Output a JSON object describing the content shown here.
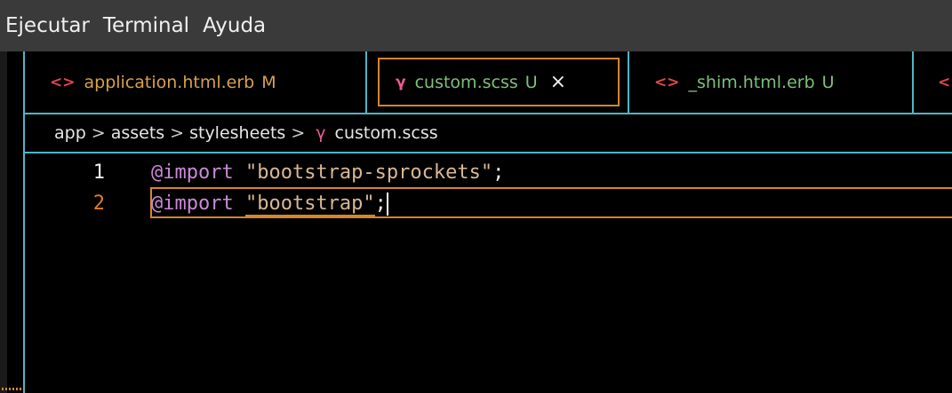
{
  "menu": {
    "items": [
      "Ejecutar",
      "Terminal",
      "Ayuda"
    ]
  },
  "tabs": [
    {
      "icon": "<>",
      "label": "application.html.erb",
      "status": "M",
      "icon_color": "#e0484c",
      "label_color": "#d6a24a"
    },
    {
      "icon": "γ",
      "label": "custom.scss",
      "status": "U",
      "icon_color": "#ee5b96",
      "label_color": "#7ec07a",
      "close": "×"
    },
    {
      "icon": "<>",
      "label": "_shim.html.erb",
      "status": "U",
      "icon_color": "#e0484c",
      "label_color": "#7ec07a"
    },
    {
      "icon": "<",
      "icon_color": "#e0484c"
    }
  ],
  "breadcrumb": {
    "parts": [
      "app",
      "assets",
      "stylesheets"
    ],
    "separator": ">",
    "file": "custom.scss",
    "file_icon": "γ"
  },
  "code": {
    "lines": [
      {
        "number": "1",
        "keyword": "@import",
        "string": "\"bootstrap-sprockets\"",
        "end": ";"
      },
      {
        "number": "2",
        "keyword": "@import",
        "string": "\"bootstrap\"",
        "end": ";"
      }
    ]
  },
  "colors": {
    "accent_border": "#4fb6c6",
    "active_border": "#d4862c",
    "keyword": "#c98ad6",
    "string": "#d8b894"
  }
}
